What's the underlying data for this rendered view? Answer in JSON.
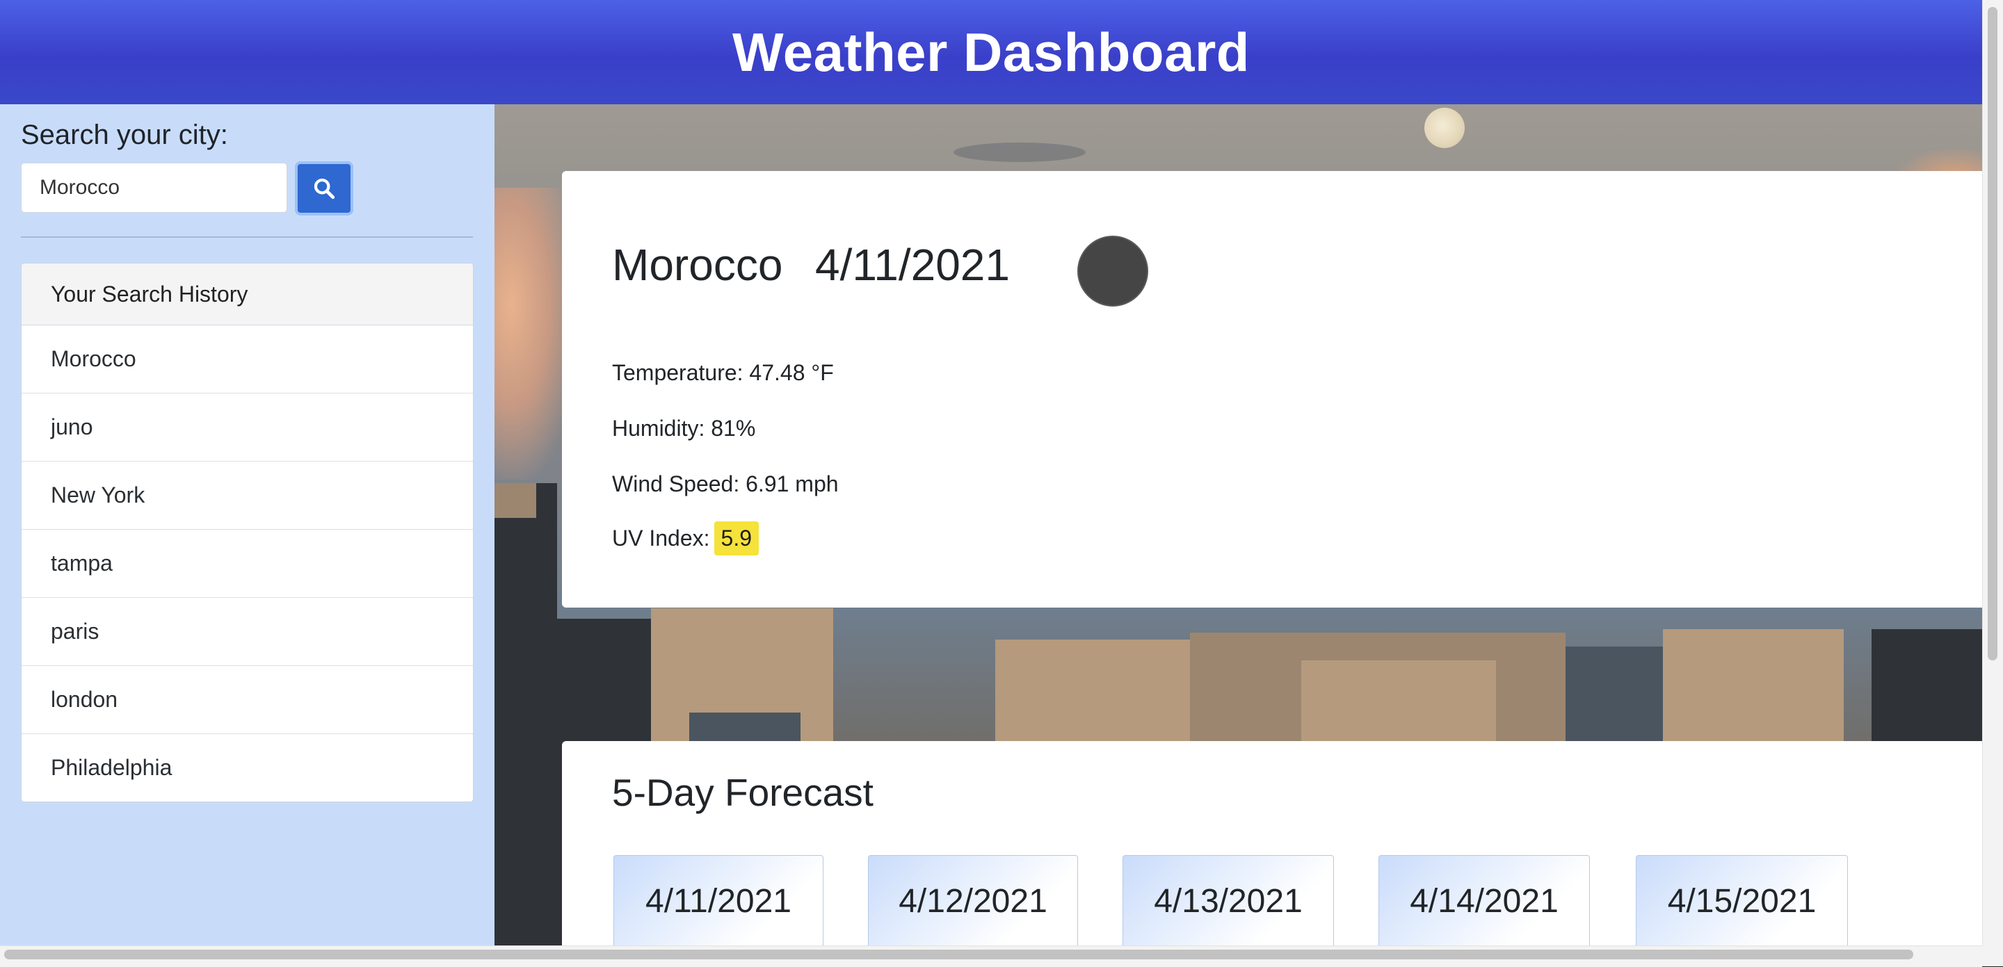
{
  "header": {
    "title": "Weather Dashboard"
  },
  "sidebar": {
    "search_label": "Search your city:",
    "search_value": "Morocco",
    "search_icon": "search-icon",
    "history_title": "Your Search History",
    "history": [
      "Morocco",
      "juno",
      "New York",
      "tampa",
      "paris",
      "london",
      "Philadelphia"
    ]
  },
  "current": {
    "city": "Morocco",
    "date": "4/11/2021",
    "icon": "weather-condition-icon",
    "temperature_label": "Temperature: 47.48 °F",
    "humidity_label": "Humidity: 81%",
    "wind_label": "Wind Speed: 6.91 mph",
    "uv_label": "UV Index:",
    "uv_value": "5.9",
    "uv_color": "#f5e23b"
  },
  "forecast": {
    "title": "5-Day Forecast",
    "days": [
      "4/11/2021",
      "4/12/2021",
      "4/13/2021",
      "4/14/2021",
      "4/15/2021"
    ]
  },
  "colors": {
    "header": "#3a3fc9",
    "sidebar": "#c8dcfa",
    "search_button": "#2e68d0"
  }
}
